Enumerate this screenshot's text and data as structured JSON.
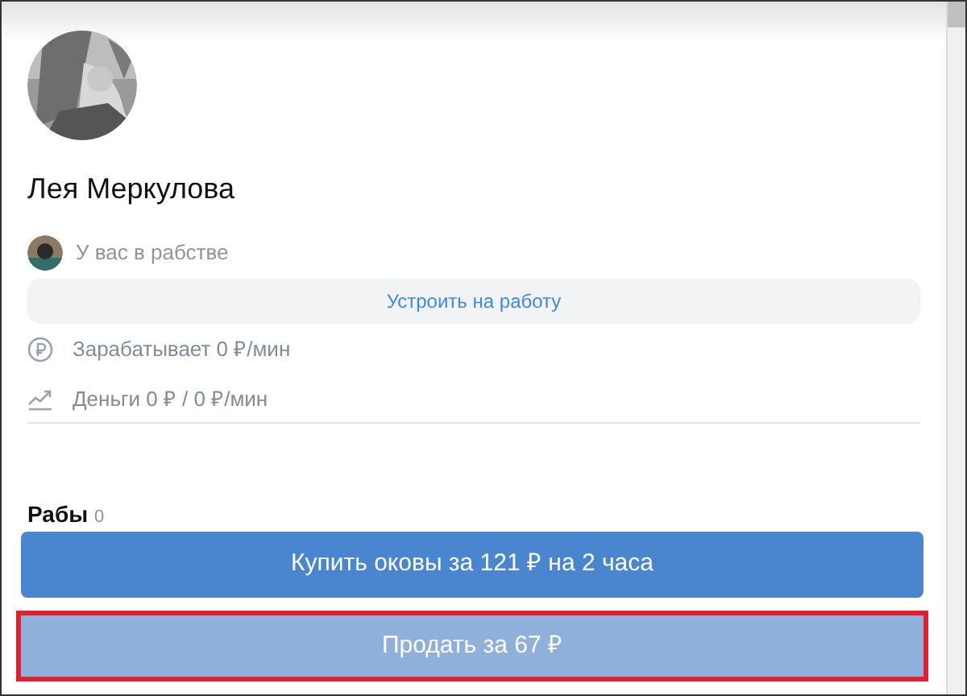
{
  "profile": {
    "name": "Лея Меркулова"
  },
  "owner": {
    "label": "У вас в рабстве"
  },
  "job_button": {
    "label": "Устроить на работу"
  },
  "stats": [
    {
      "kind": "earning",
      "text": "Зарабатывает 0 ₽/мин"
    },
    {
      "kind": "money",
      "text": "Деньги 0 ₽ / 0 ₽/мин"
    }
  ],
  "slaves": {
    "label": "Рабы",
    "count": "0"
  },
  "actions": [
    {
      "label": "Купить оковы за 121 ₽ на 2 часа",
      "disabled": false,
      "highlighted": false
    },
    {
      "label": "Продать за 67 ₽",
      "disabled": true,
      "highlighted": true
    }
  ]
}
